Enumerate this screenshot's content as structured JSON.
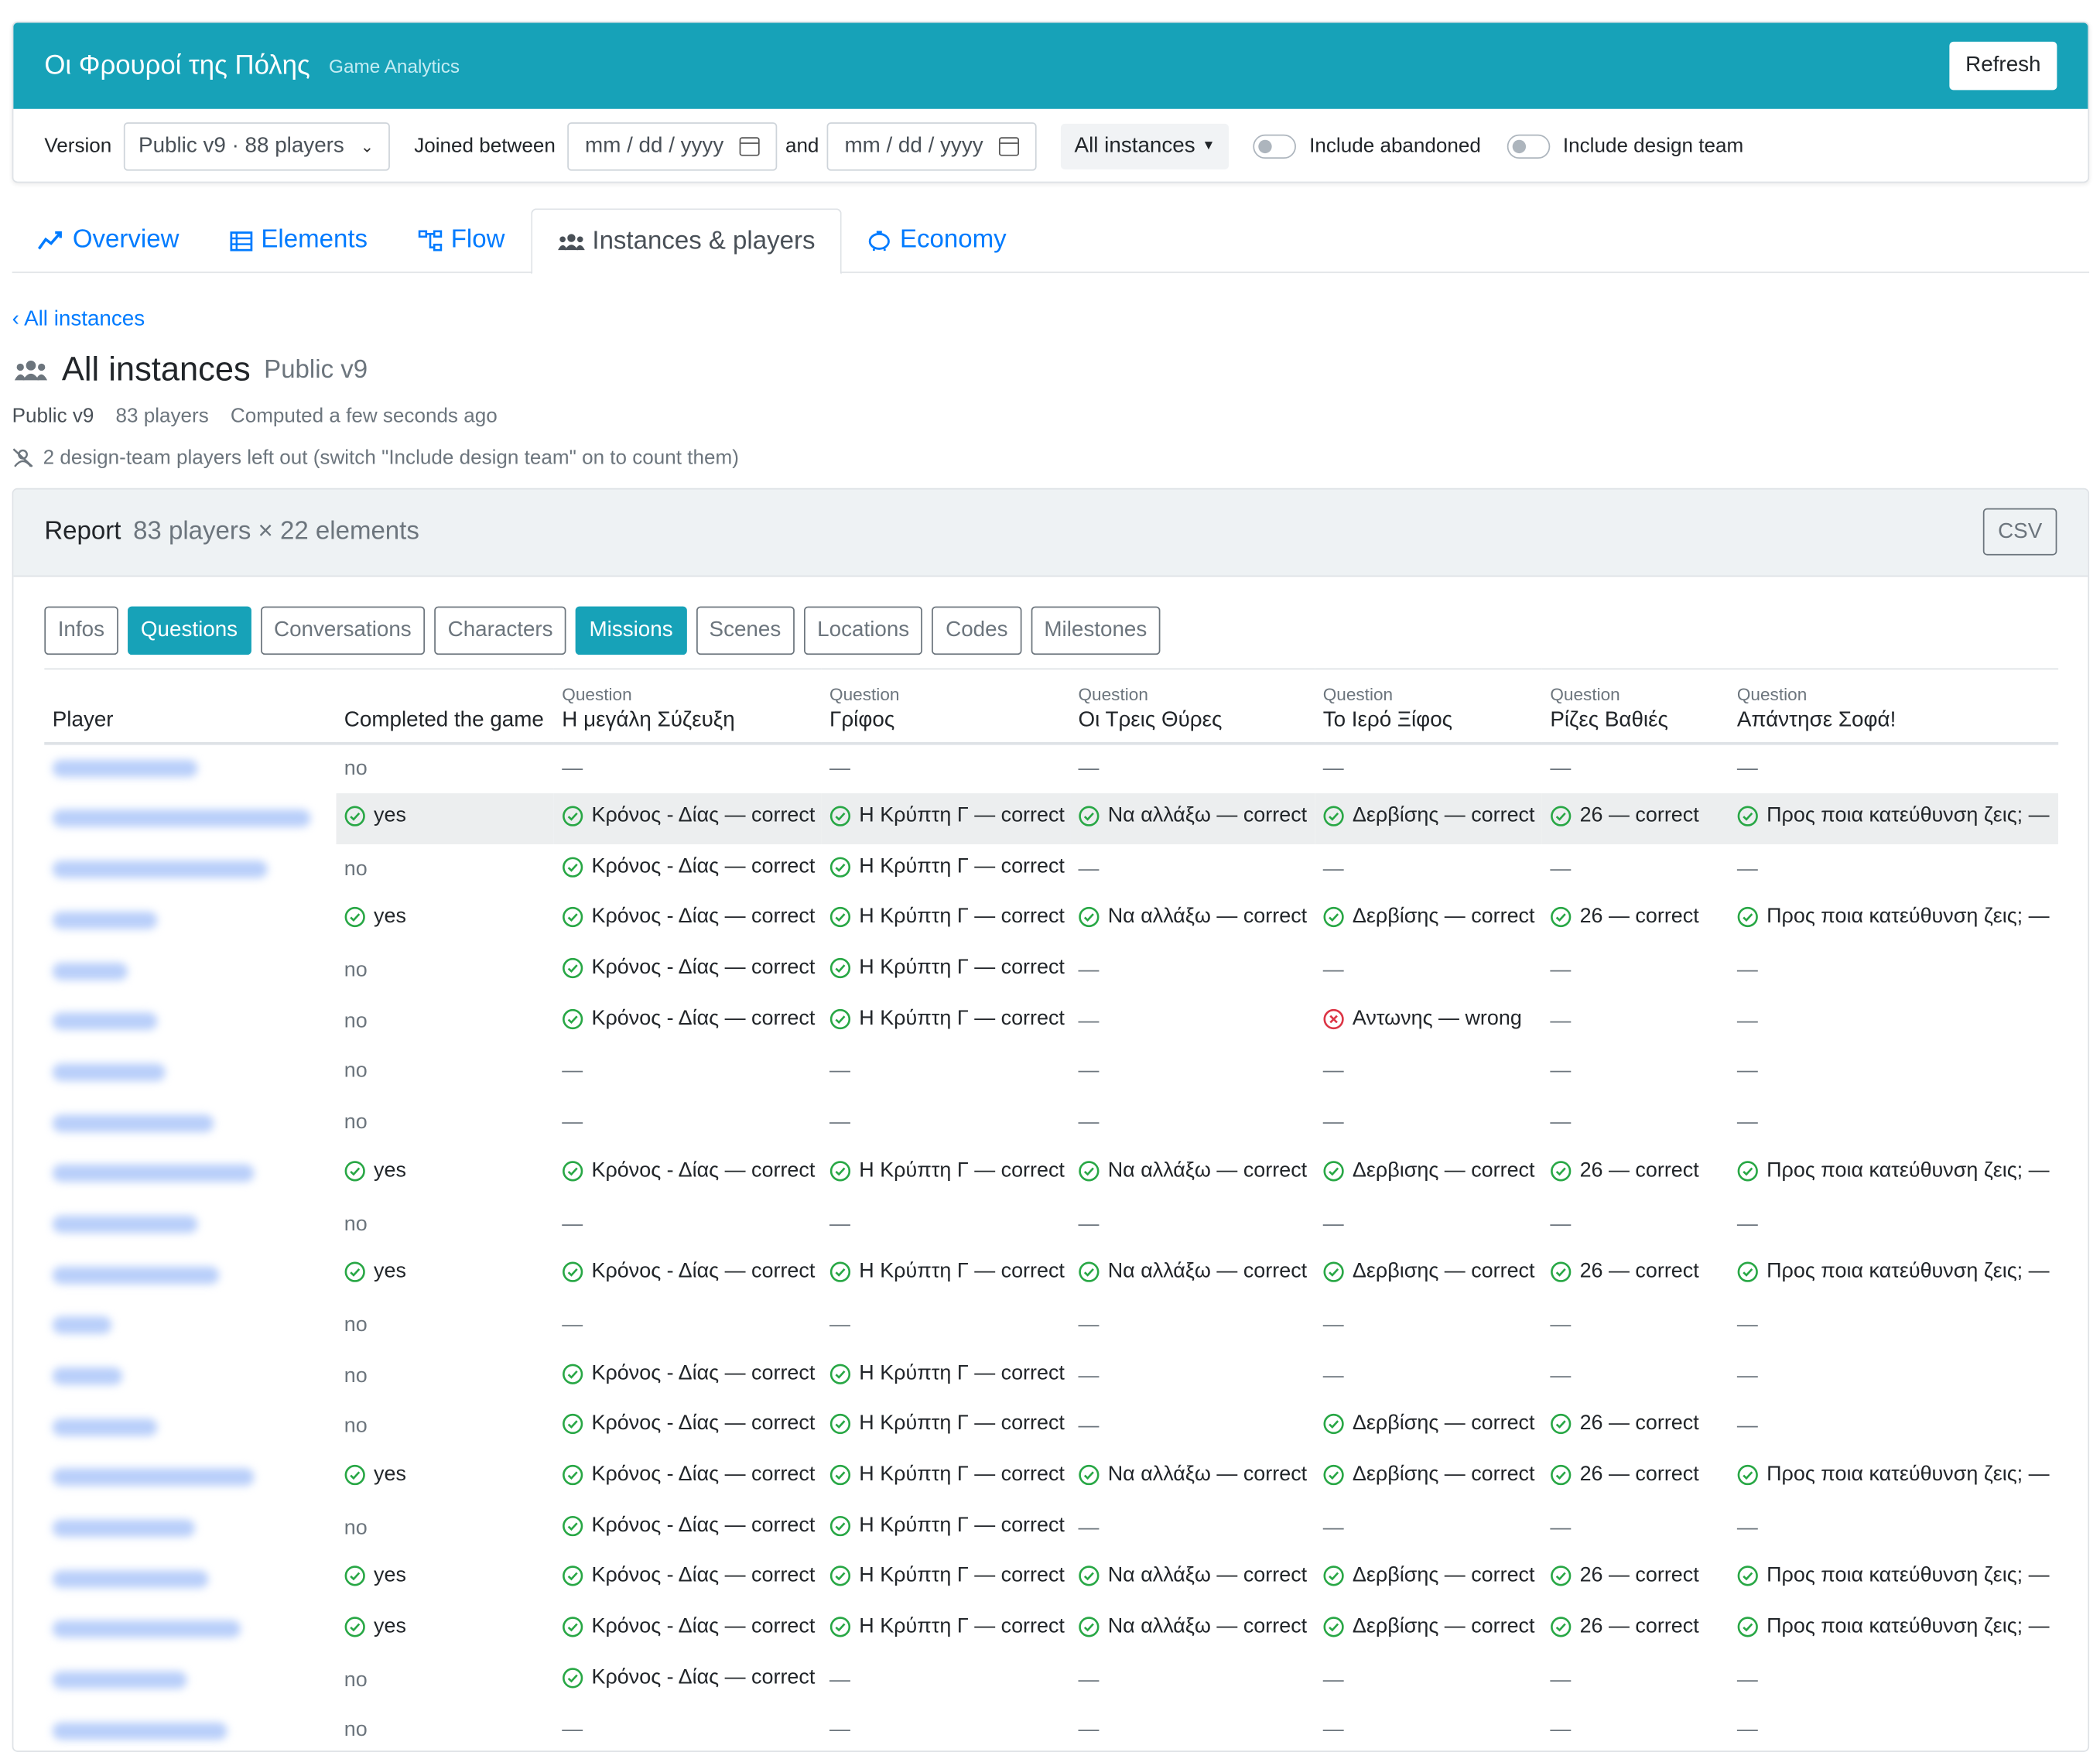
{
  "app": {
    "title": "Οι Φρουροί της Πόλης",
    "subtitle": "Game Analytics",
    "refresh_label": "Refresh"
  },
  "filters": {
    "version_label": "Version",
    "version_value": "Public v9 · 88 players",
    "joined_label": "Joined between",
    "date_placeholder": "mm / dd / yyyy",
    "and_label": "and",
    "instances_label": "All instances",
    "abandoned_label": "Include abandoned",
    "design_team_label": "Include design team"
  },
  "tabs": [
    {
      "label": "Overview",
      "icon": "chart-line-icon"
    },
    {
      "label": "Elements",
      "icon": "list-icon"
    },
    {
      "label": "Flow",
      "icon": "sitemap-icon"
    },
    {
      "label": "Instances & players",
      "icon": "users-icon",
      "active": true
    },
    {
      "label": "Economy",
      "icon": "piggy-bank-icon"
    }
  ],
  "page": {
    "back_link": "‹ All instances",
    "title": "All instances",
    "subtitle": "Public v9",
    "meta_version": "Public v9",
    "meta_players": "83 players",
    "meta_computed": "Computed a few seconds ago",
    "note": "2 design-team players left out (switch \"Include design team\" on to count them)"
  },
  "report": {
    "title": "Report",
    "subtitle": "83 players × 22 elements",
    "csv_label": "CSV",
    "chips": [
      {
        "label": "Infos",
        "active": false
      },
      {
        "label": "Questions",
        "active": true
      },
      {
        "label": "Conversations",
        "active": false
      },
      {
        "label": "Characters",
        "active": false
      },
      {
        "label": "Missions",
        "active": true
      },
      {
        "label": "Scenes",
        "active": false
      },
      {
        "label": "Locations",
        "active": false
      },
      {
        "label": "Codes",
        "active": false
      },
      {
        "label": "Milestones",
        "active": false
      }
    ]
  },
  "table": {
    "columns": [
      {
        "kind": "",
        "name": "Player"
      },
      {
        "kind": "",
        "name": "Completed the game"
      },
      {
        "kind": "Question",
        "name": "Η μεγάλη Σύζευξη"
      },
      {
        "kind": "Question",
        "name": "Γρίφος"
      },
      {
        "kind": "Question",
        "name": "Οι Τρεις Θύρες"
      },
      {
        "kind": "Question",
        "name": "Το Ιερό Ξίφος"
      },
      {
        "kind": "Question",
        "name": "Ρίζες Βαθιές"
      },
      {
        "kind": "Question",
        "name": "Απάντησε Σοφά!"
      }
    ],
    "rows": [
      [
        "no",
        "—",
        "—",
        "—",
        "—",
        "—",
        "—"
      ],
      [
        "yes",
        "Κρόνος - Δίας — correct",
        "Η Κρύπτη Γ — correct",
        "Να αλλάξω — correct",
        "Δερβίσης — correct",
        "26 — correct",
        "Προς ποια κατεύθυνση ζεις; —"
      ],
      [
        "no",
        "Κρόνος - Δίας — correct",
        "Η Κρύπτη Γ — correct",
        "—",
        "—",
        "—",
        "—"
      ],
      [
        "yes",
        "Κρόνος - Δίας — correct",
        "Η Κρύπτη Γ — correct",
        "Να αλλάξω — correct",
        "Δερβίσης — correct",
        "26 — correct",
        "Προς ποια κατεύθυνση ζεις; —"
      ],
      [
        "no",
        "Κρόνος - Δίας — correct",
        "Η Κρύπτη Γ — correct",
        "—",
        "—",
        "—",
        "—"
      ],
      [
        "no",
        "Κρόνος - Δίας — correct",
        "Η Κρύπτη Γ — correct",
        "—",
        "Αντωνης — wrong",
        "—",
        "—"
      ],
      [
        "no",
        "—",
        "—",
        "—",
        "—",
        "—",
        "—"
      ],
      [
        "no",
        "—",
        "—",
        "—",
        "—",
        "—",
        "—"
      ],
      [
        "yes",
        "Κρόνος - Δίας — correct",
        "Η Κρύπτη Γ — correct",
        "Να αλλάξω — correct",
        "Δερβισης — correct",
        "26 — correct",
        "Προς ποια κατεύθυνση ζεις; —"
      ],
      [
        "no",
        "—",
        "—",
        "—",
        "—",
        "—",
        "—"
      ],
      [
        "yes",
        "Κρόνος - Δίας — correct",
        "Η Κρύπτη Γ — correct",
        "Να αλλάξω — correct",
        "Δερβισης — correct",
        "26 — correct",
        "Προς ποια κατεύθυνση ζεις; —"
      ],
      [
        "no",
        "—",
        "—",
        "—",
        "—",
        "—",
        "—"
      ],
      [
        "no",
        "Κρόνος - Δίας — correct",
        "Η Κρύπτη Γ — correct",
        "—",
        "—",
        "—",
        "—"
      ],
      [
        "no",
        "Κρόνος - Δίας — correct",
        "Η Κρύπτη Γ — correct",
        "—",
        "Δερβίσης — correct",
        "26 — correct",
        "—"
      ],
      [
        "yes",
        "Κρόνος - Δίας — correct",
        "Η Κρύπτη Γ — correct",
        "Να αλλάξω — correct",
        "Δερβίσης — correct",
        "26 — correct",
        "Προς ποια κατεύθυνση ζεις; —"
      ],
      [
        "no",
        "Κρόνος - Δίας — correct",
        "Η Κρύπτη Γ — correct",
        "—",
        "—",
        "—",
        "—"
      ],
      [
        "yes",
        "Κρόνος - Δίας — correct",
        "Η Κρύπτη Γ — correct",
        "Να αλλάξω — correct",
        "Δερβίσης — correct",
        "26 — correct",
        "Προς ποια κατεύθυνση ζεις; —"
      ],
      [
        "yes",
        "Κρόνος - Δίας — correct",
        "Η Κρύπτη Γ — correct",
        "Να αλλάξω — correct",
        "Δερβίσης — correct",
        "26 — correct",
        "Προς ποια κατεύθυνση ζεις; —"
      ],
      [
        "no",
        "Κρόνος - Δίας — correct",
        "—",
        "—",
        "—",
        "—",
        "—"
      ],
      [
        "no",
        "—",
        "—",
        "—",
        "—",
        "—",
        "—"
      ]
    ],
    "highlighted_row": 1
  },
  "colors": {
    "brand": "#17a2b8",
    "link": "#007bff",
    "correct": "#28a745",
    "wrong": "#dc3545"
  }
}
